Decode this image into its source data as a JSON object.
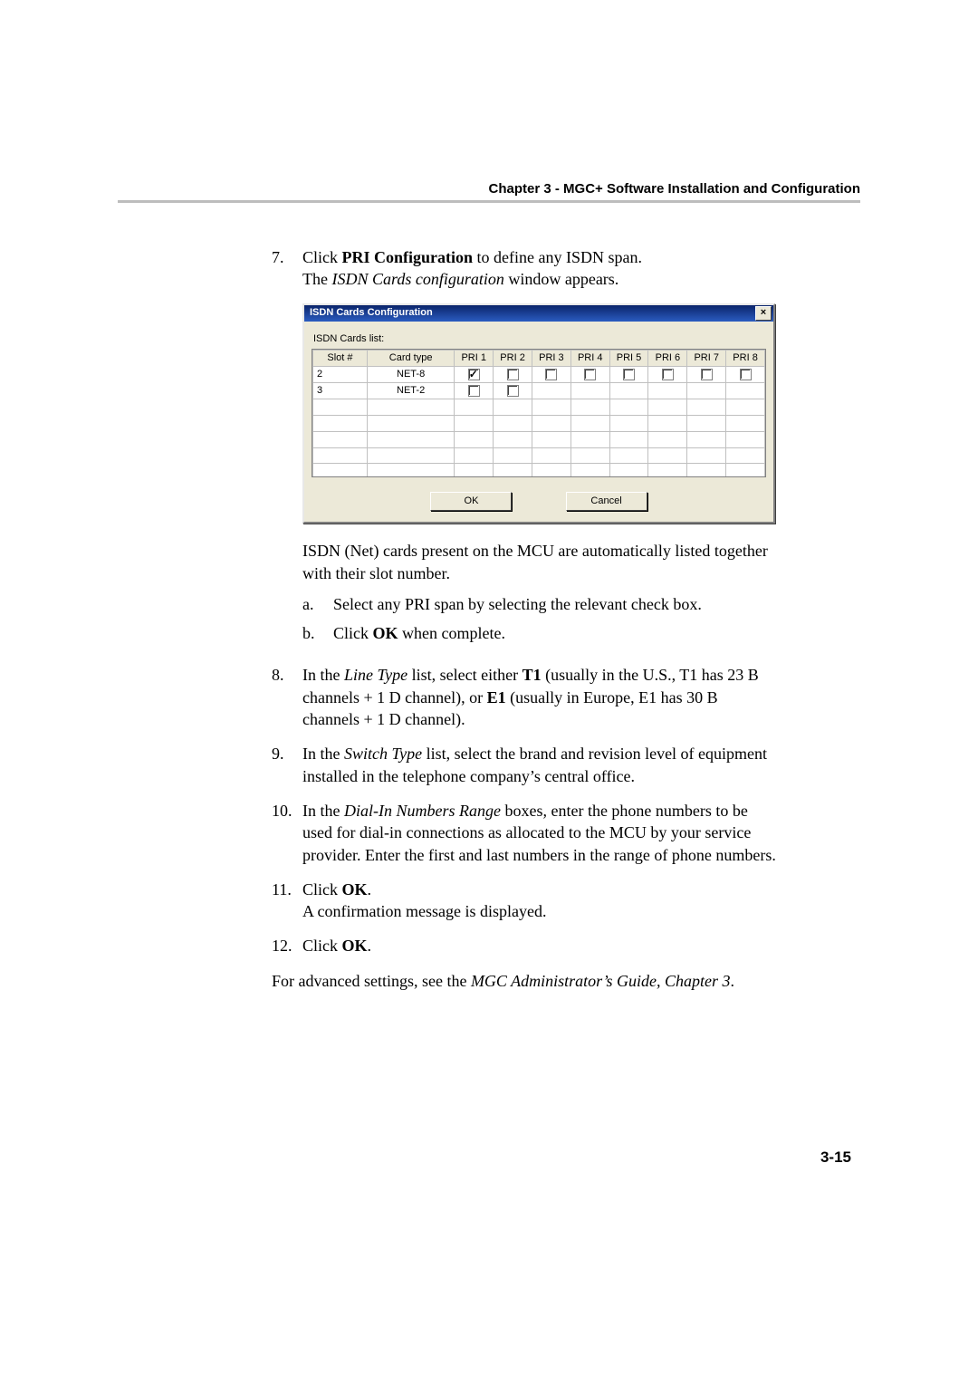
{
  "header": {
    "chapter_line": "Chapter 3 - MGC+ Software Installation and Configuration"
  },
  "step7": {
    "num": "7.",
    "line1_a": "Click ",
    "line1_b": "PRI Configuration",
    "line1_c": " to define any ISDN span.",
    "line2_a": "The ",
    "line2_b": "ISDN Cards configuration",
    "line2_c": " window appears."
  },
  "dialog": {
    "title": "ISDN Cards Configuration",
    "close_glyph": "×",
    "list_label": "ISDN Cards list:",
    "headers": {
      "slot": "Slot #",
      "card": "Card type",
      "pri1": "PRI 1",
      "pri2": "PRI 2",
      "pri3": "PRI 3",
      "pri4": "PRI 4",
      "pri5": "PRI 5",
      "pri6": "PRI 6",
      "pri7": "PRI 7",
      "pri8": "PRI 8"
    },
    "rows": [
      {
        "slot": "2",
        "card": "NET-8",
        "pri": [
          "checked",
          "",
          "",
          "",
          "",
          "",
          "",
          ""
        ]
      },
      {
        "slot": "3",
        "card": "NET-2",
        "pri": [
          "",
          "",
          null,
          null,
          null,
          null,
          null,
          null
        ]
      }
    ],
    "ok_label": "OK",
    "cancel_label": "Cancel"
  },
  "after_dialog": {
    "para": "ISDN (Net) cards present on the MCU are automatically listed together with their slot number.",
    "a_lt": "a.",
    "a_txt": "Select any PRI span by selecting the relevant check box.",
    "b_lt": "b.",
    "b_txt_a": "Click ",
    "b_txt_b": "OK",
    "b_txt_c": " when complete."
  },
  "step8": {
    "num": "8.",
    "a": "In the ",
    "b": "Line Type",
    "c": " list, select either ",
    "d": "T1",
    "e": " (usually in the U.S., T1 has 23 B channels + 1 D channel), or ",
    "f": "E1",
    "g": " (usually in Europe, E1 has 30 B channels + 1 D channel)."
  },
  "step9": {
    "num": "9.",
    "a": "In the ",
    "b": "Switch Type",
    "c": " list, select the brand and revision level of equipment installed in the telephone company’s central office."
  },
  "step10": {
    "num": "10.",
    "a": "In the ",
    "b": "Dial-In Numbers Range",
    "c": " boxes",
    "d": ", ",
    "e": "enter the phone numbers to be used for dial-in connections as allocated to the MCU by your service provider. Enter the first and last numbers in the range of phone numbers."
  },
  "step11": {
    "num": "11.",
    "a": "Click ",
    "b": "OK",
    "c": ".",
    "line2": "A confirmation message is displayed."
  },
  "step12": {
    "num": "12.",
    "a": "Click ",
    "b": "OK",
    "c": "."
  },
  "final": {
    "a": "For advanced settings, see the ",
    "b": "MGC Administrator’s Guide, Chapter 3",
    "c": "."
  },
  "pagenum": "3-15"
}
